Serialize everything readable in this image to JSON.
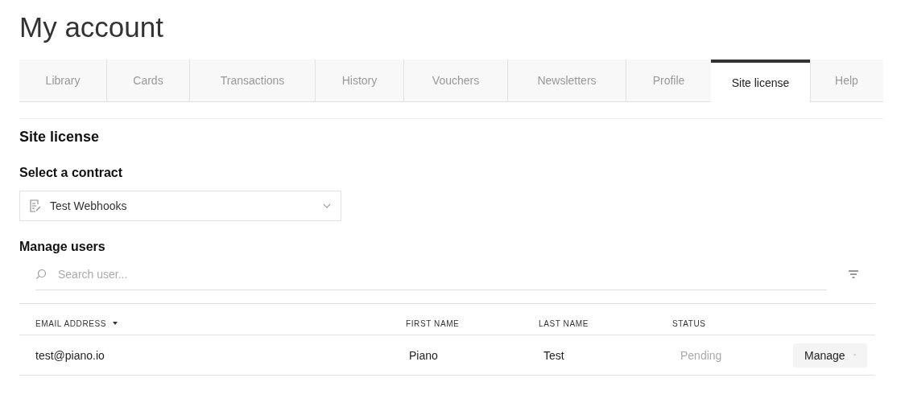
{
  "page_title": "My account",
  "tabs": [
    {
      "label": "Library",
      "selected": false
    },
    {
      "label": "Cards",
      "selected": false
    },
    {
      "label": "Transactions",
      "selected": false
    },
    {
      "label": "History",
      "selected": false
    },
    {
      "label": "Vouchers",
      "selected": false
    },
    {
      "label": "Newsletters",
      "selected": false
    },
    {
      "label": "Profile",
      "selected": false
    },
    {
      "label": "Site license",
      "selected": true
    },
    {
      "label": "Help",
      "selected": false
    }
  ],
  "section_title": "Site license",
  "contract": {
    "label": "Select a contract",
    "value": "Test Webhooks"
  },
  "users": {
    "title": "Manage users",
    "search": {
      "placeholder": "Search user..."
    },
    "columns": [
      {
        "label": "EMAIL ADDRESS",
        "sorted": true
      },
      {
        "label": "FIRST NAME",
        "sorted": false
      },
      {
        "label": "LAST NAME",
        "sorted": false
      },
      {
        "label": "STATUS",
        "sorted": false
      }
    ],
    "rows": [
      {
        "email": "test@piano.io",
        "first_name": "Piano",
        "last_name": "Test",
        "status": "Pending",
        "action": "Manage"
      }
    ]
  }
}
